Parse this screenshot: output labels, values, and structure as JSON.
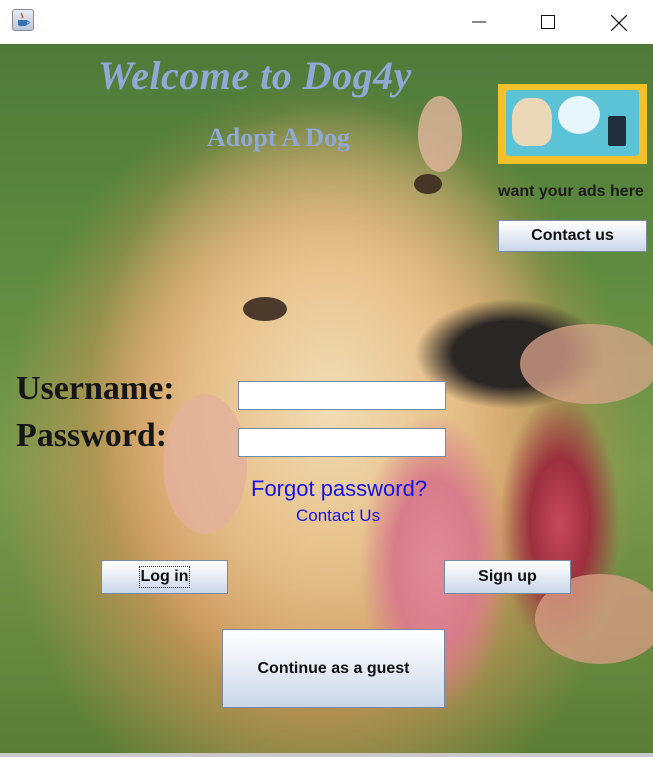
{
  "window": {
    "app_icon": "java-coffee-cup-icon",
    "controls": [
      "minimize-icon",
      "maximize-icon",
      "close-icon"
    ]
  },
  "header": {
    "title": "Welcome to Dog4y",
    "subtitle": "Adopt A Dog"
  },
  "ad": {
    "text": "want your ads here",
    "contact_label": "Contact us"
  },
  "login": {
    "username_label": "Username:",
    "password_label": "Password:",
    "username_value": "",
    "password_value": "",
    "forgot_password": "Forgot password?",
    "contact_us": "Contact Us",
    "login_label": "Log in",
    "signup_label": "Sign up",
    "guest_label": "Continue as a guest"
  },
  "colors": {
    "title": "#8fa8d4",
    "link": "#1414e6"
  }
}
